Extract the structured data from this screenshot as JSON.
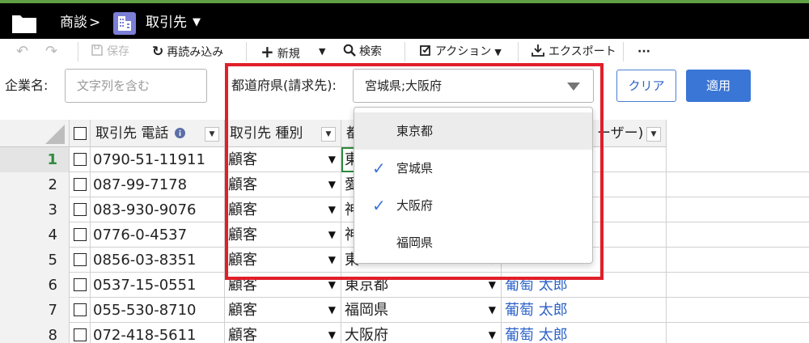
{
  "header": {
    "breadcrumb_root": "商談",
    "separator": ">",
    "current": "取引先",
    "caret": "▼"
  },
  "toolbar": {
    "undo": "↶",
    "redo": "↷",
    "save": "保存",
    "reload": "再読み込み",
    "new": "新規",
    "search": "検索",
    "action": "アクション",
    "export": "エクスポート",
    "more": "···"
  },
  "filters": {
    "company_label": "企業名:",
    "company_placeholder": "文字列を含む",
    "prefecture_label": "都道府県(請求先):",
    "prefecture_value": "宮城県;大阪府",
    "clear_label": "クリア",
    "apply_label": "適用"
  },
  "dropdown": {
    "options": [
      {
        "label": "東京都",
        "checked": false,
        "hover": true
      },
      {
        "label": "宮城県",
        "checked": true,
        "hover": false
      },
      {
        "label": "大阪府",
        "checked": true,
        "hover": false
      },
      {
        "label": "福岡県",
        "checked": false,
        "hover": false
      }
    ]
  },
  "grid": {
    "columns": [
      {
        "label": "取引先 電話"
      },
      {
        "label": "取引先 種別"
      },
      {
        "label": "都"
      },
      {
        "label": "ーザー)"
      }
    ],
    "rows": [
      {
        "num": "1",
        "phone": "0790-51-11911",
        "type": "顧客",
        "pref": "東",
        "owner": ""
      },
      {
        "num": "2",
        "phone": "087-99-7178",
        "type": "顧客",
        "pref": "愛",
        "owner": ""
      },
      {
        "num": "3",
        "phone": "083-930-9076",
        "type": "顧客",
        "pref": "神",
        "owner": ""
      },
      {
        "num": "4",
        "phone": "0776-0-4537",
        "type": "顧客",
        "pref": "神",
        "owner": ""
      },
      {
        "num": "5",
        "phone": "0856-03-8351",
        "type": "顧客",
        "pref": "東",
        "owner": ""
      },
      {
        "num": "6",
        "phone": "0537-15-0551",
        "type": "顧客",
        "pref": "東京都",
        "owner": "葡萄 太郎"
      },
      {
        "num": "7",
        "phone": "055-530-8710",
        "type": "顧客",
        "pref": "福岡県",
        "owner": "葡萄 太郎"
      },
      {
        "num": "8",
        "phone": "072-418-5611",
        "type": "顧客",
        "pref": "大阪府",
        "owner": "葡萄 太郎"
      }
    ]
  },
  "colors": {
    "accent_green": "#5fa044",
    "link_blue": "#2d63c8",
    "apply_blue": "#3a76d6",
    "highlight_red": "#e01f2a"
  },
  "icons": {
    "folder": "folder-icon",
    "building": "building-icon",
    "info": "info-icon",
    "check": "checkmark-icon"
  }
}
